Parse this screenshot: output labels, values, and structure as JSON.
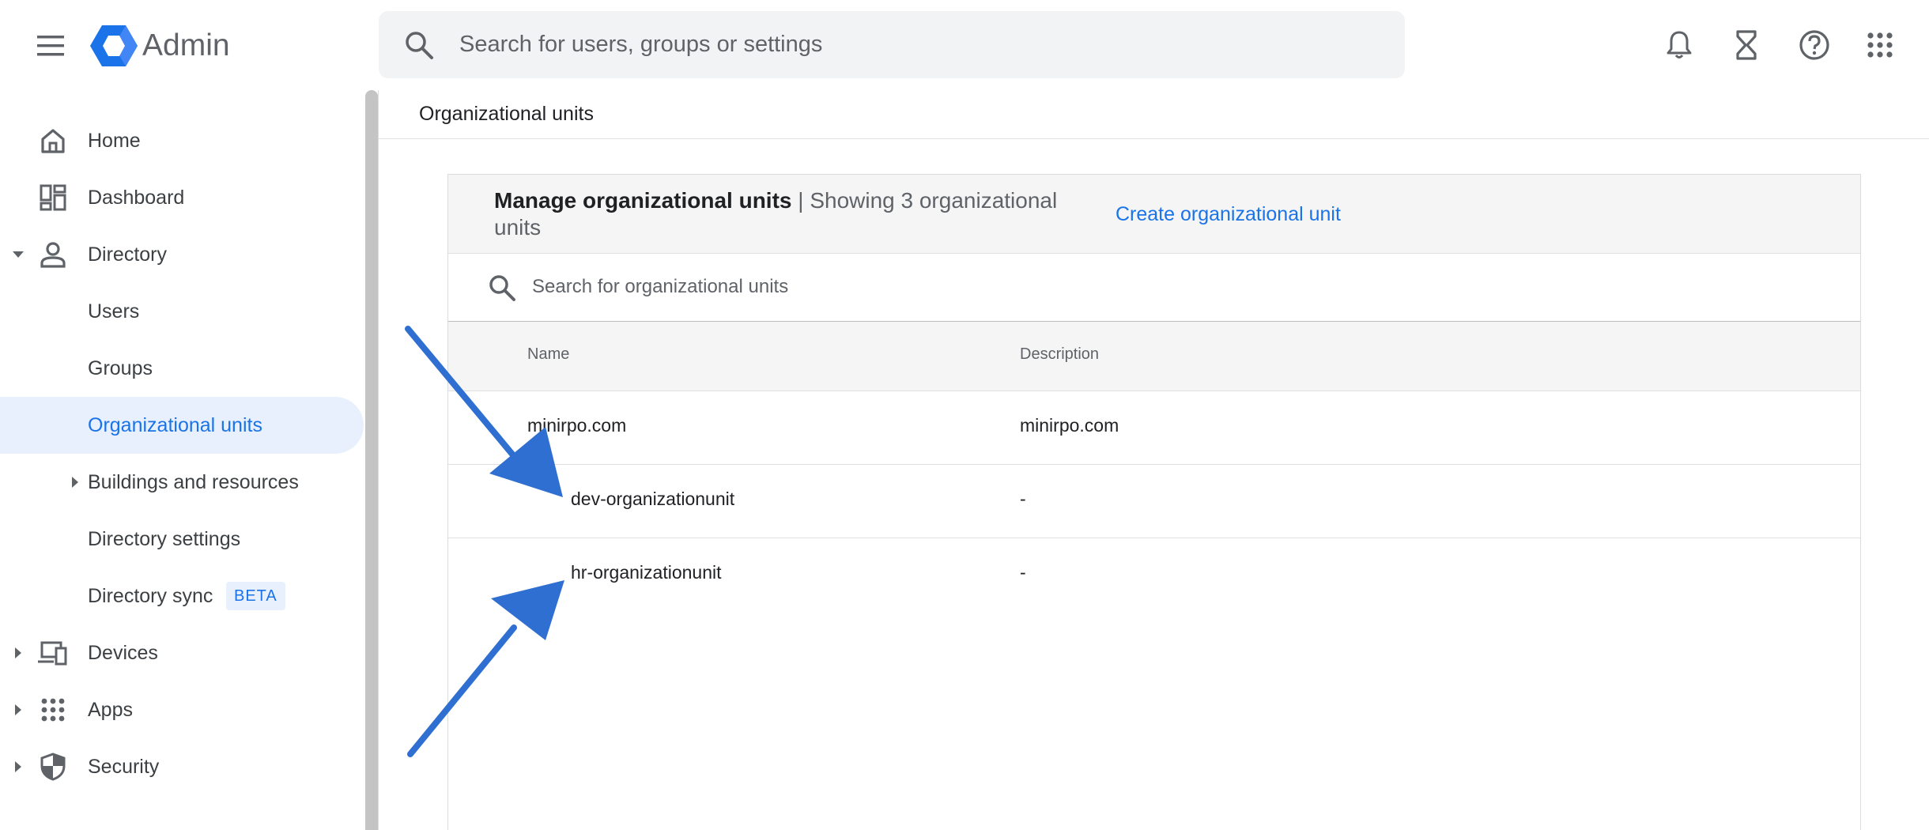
{
  "header": {
    "app_title": "Admin",
    "search_placeholder": "Search for users, groups or settings",
    "icons": [
      "menu-icon",
      "admin-logo-icon",
      "search-icon",
      "notifications-bell-icon",
      "hourglass-icon",
      "help-icon",
      "apps-grid-icon"
    ]
  },
  "sidebar": {
    "items": [
      {
        "label": "Home",
        "icon": "home-icon"
      },
      {
        "label": "Dashboard",
        "icon": "dashboard-icon"
      },
      {
        "label": "Directory",
        "icon": "person-icon",
        "expanded": true
      },
      {
        "label": "Users"
      },
      {
        "label": "Groups"
      },
      {
        "label": "Organizational units",
        "active": true
      },
      {
        "label": "Buildings and resources",
        "collapsed": true
      },
      {
        "label": "Directory settings"
      },
      {
        "label": "Directory sync",
        "badge": "BETA"
      },
      {
        "label": "Devices",
        "icon": "devices-icon",
        "collapsed": true
      },
      {
        "label": "Apps",
        "icon": "apps-icon",
        "collapsed": true
      },
      {
        "label": "Security",
        "icon": "shield-icon",
        "collapsed": true
      }
    ]
  },
  "main": {
    "breadcrumb": "Organizational units",
    "card": {
      "title_strong": "Manage organizational units",
      "title_rest": " | Showing 3 organizational units",
      "create_link": "Create organizational unit",
      "search_placeholder": "Search for organizational units",
      "columns": [
        "Name",
        "Description"
      ],
      "rows": [
        {
          "name": "minirpo.com",
          "description": "minirpo.com",
          "level": 0
        },
        {
          "name": "dev-organizationunit",
          "description": "-",
          "level": 1
        },
        {
          "name": "hr-organizationunit",
          "description": "-",
          "level": 1
        }
      ]
    }
  },
  "colors": {
    "accent": "#1a73e8",
    "annotation_arrow": "#2f6fd1",
    "active_bg": "#e8f0fe",
    "header_bg": "#f5f5f5"
  }
}
